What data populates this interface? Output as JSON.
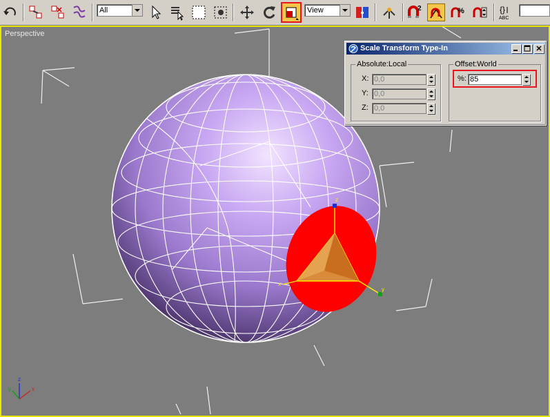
{
  "toolbar": {
    "selection_filter": "All",
    "reference_coordinate_system": "View",
    "tools": [
      {
        "name": "undo-icon"
      },
      {
        "name": "select-and-link-icon"
      },
      {
        "name": "unlink-selection-icon"
      },
      {
        "name": "bind-to-space-warp-icon"
      },
      {
        "name": "select-object-icon"
      },
      {
        "name": "select-by-name-icon"
      },
      {
        "name": "rectangular-selection-region-icon"
      },
      {
        "name": "window-crossing-icon"
      },
      {
        "name": "select-and-move-icon"
      },
      {
        "name": "select-and-rotate-icon"
      },
      {
        "name": "select-and-scale-icon"
      },
      {
        "name": "use-pivot-point-center-icon"
      },
      {
        "name": "select-and-manipulate-icon"
      },
      {
        "name": "snaps-toggle-icon"
      },
      {
        "name": "angle-snap-toggle-icon"
      },
      {
        "name": "percent-snap-toggle-icon"
      },
      {
        "name": "spinner-snap-toggle-icon"
      },
      {
        "name": "edit-named-selection-sets-icon"
      }
    ],
    "percent_snap_label": "%",
    "spell_label": "ABC"
  },
  "viewport": {
    "label": "Perspective",
    "gizmo_labels": {
      "x": "x",
      "y": "y",
      "z": "z"
    },
    "axis_tripod": {
      "x": "x",
      "y": "y",
      "z": "z"
    }
  },
  "dialog": {
    "title": "Scale Transform Type-In",
    "absolute": {
      "title": "Absolute:Local",
      "x_label": "X:",
      "x_value": "0,0",
      "y_label": "Y:",
      "y_value": "0,0",
      "z_label": "Z:",
      "z_value": "0,0"
    },
    "offset": {
      "title": "Offset:World",
      "percent_label": "%:",
      "percent_value": "85"
    }
  },
  "colors": {
    "viewport_bg": "#7d7d7d",
    "sphere": "#b38ee8",
    "selection": "#ff0000",
    "active_button": "#f3c64a",
    "highlight_box": "#e8141e"
  }
}
